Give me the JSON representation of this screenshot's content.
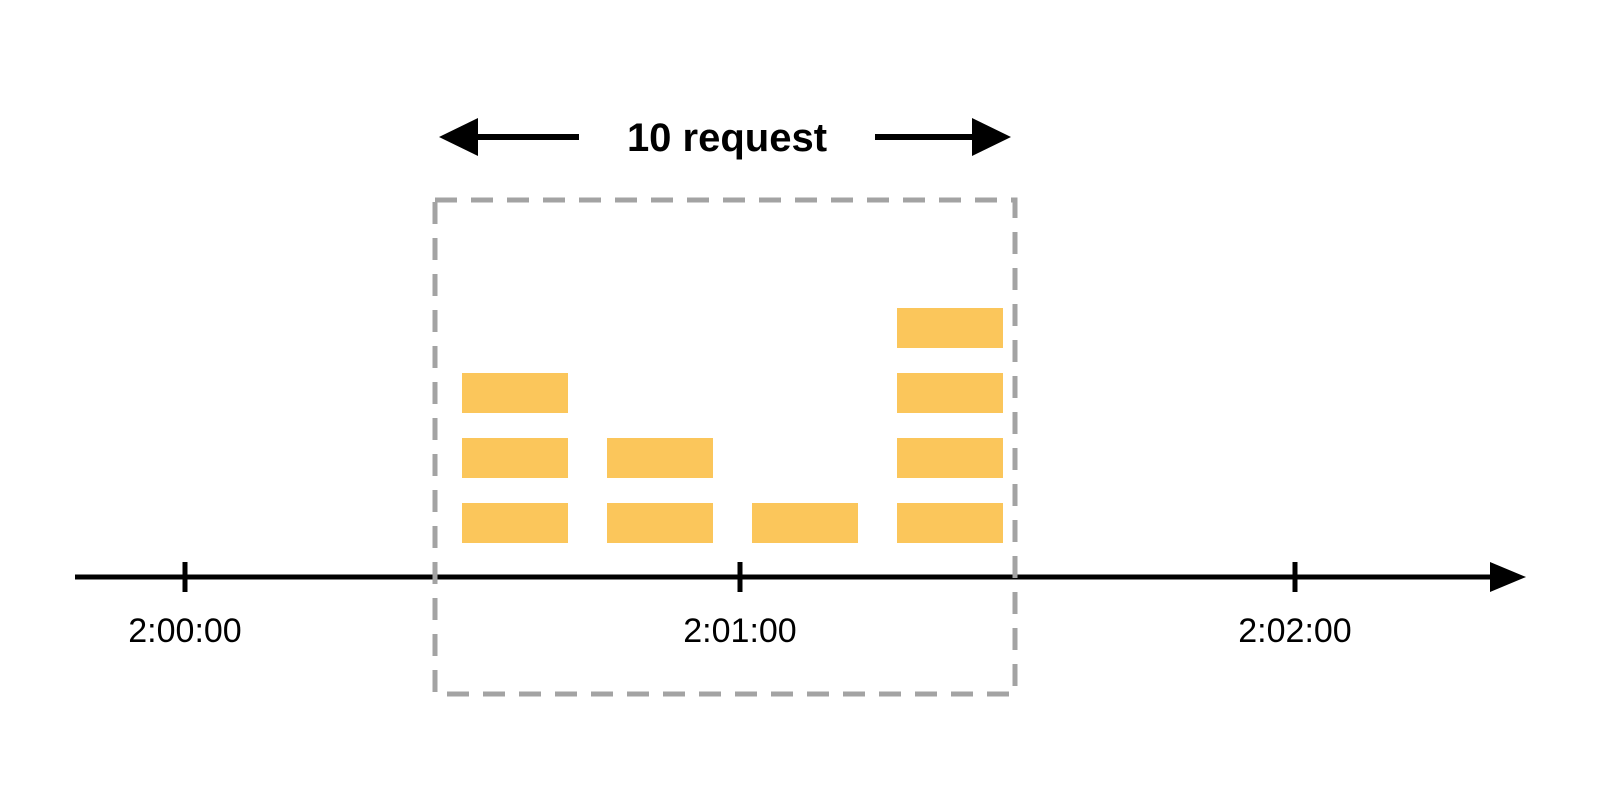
{
  "diagram": {
    "title": "10 request",
    "window": {
      "start": "2:00:30",
      "end": "2:01:30"
    },
    "axis": {
      "ticks": [
        "2:00:00",
        "2:01:00",
        "2:02:00"
      ]
    },
    "bar_color": "#fbc65b",
    "columns": [
      {
        "time": "2:00:38",
        "count": 3
      },
      {
        "time": "2:00:53",
        "count": 2
      },
      {
        "time": "2:01:08",
        "count": 1
      },
      {
        "time": "2:01:23",
        "count": 4
      }
    ],
    "total_requests": 10
  },
  "chart_data": {
    "type": "bar",
    "title": "10 request",
    "xlabel": "",
    "ylabel": "",
    "categories": [
      "2:00:38",
      "2:00:53",
      "2:01:08",
      "2:01:23"
    ],
    "values": [
      3,
      2,
      1,
      4
    ],
    "x_ticks": [
      "2:00:00",
      "2:01:00",
      "2:02:00"
    ],
    "window": {
      "start": "2:00:30",
      "end": "2:01:30"
    },
    "ylim": [
      0,
      4
    ]
  }
}
